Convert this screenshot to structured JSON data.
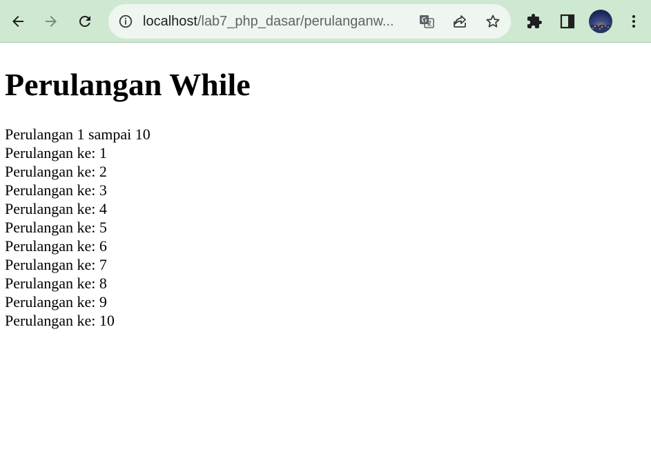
{
  "browser": {
    "url_host": "localhost",
    "url_path": "/lab7_php_dasar/perulanganw...",
    "icons": {
      "back": "arrow-left-icon",
      "forward": "arrow-right-icon",
      "reload": "reload-icon",
      "site_info": "info-icon",
      "translate": "translate-icon",
      "share": "share-icon",
      "bookmark": "star-icon",
      "extensions": "puzzle-icon",
      "side_panel": "side-panel-icon",
      "profile": "avatar",
      "menu": "more-vert-icon"
    },
    "colors": {
      "toolbar_bg": "#cfe8d2",
      "omnibox_bg": "#eef6ef"
    }
  },
  "page": {
    "heading": "Perulangan While",
    "intro": "Perulangan 1 sampai 10",
    "lines": [
      "Perulangan ke: 1",
      "Perulangan ke: 2",
      "Perulangan ke: 3",
      "Perulangan ke: 4",
      "Perulangan ke: 5",
      "Perulangan ke: 6",
      "Perulangan ke: 7",
      "Perulangan ke: 8",
      "Perulangan ke: 9",
      "Perulangan ke: 10"
    ]
  }
}
